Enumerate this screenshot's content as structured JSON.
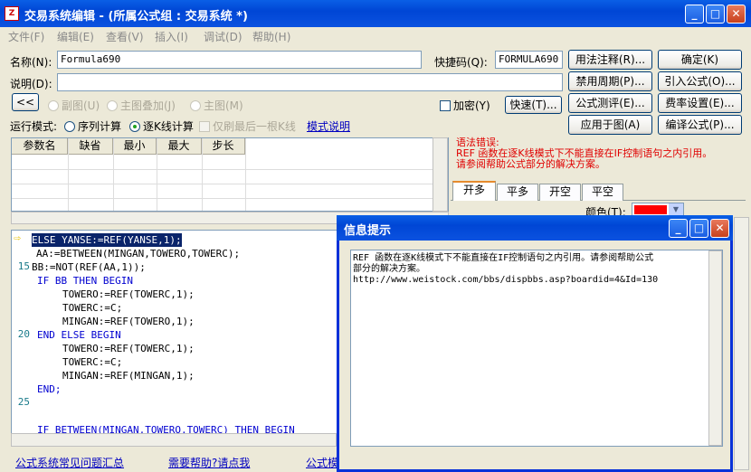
{
  "window": {
    "title": "交易系统编辑 - (所属公式组 : 交易系统 *)",
    "app_icon": "Z"
  },
  "menu": [
    "文件(F)",
    "编辑(E)",
    "查看(V)",
    "插入(I)",
    "调试(D)",
    "帮助(H)"
  ],
  "form": {
    "name_label": "名称(N):",
    "name_value": "Formula690",
    "code_label": "快捷码(Q):",
    "code_value": "FORMULA690",
    "desc_label": "说明(D):",
    "desc_value": ""
  },
  "buttons": {
    "usage": "用法注释(R)...",
    "ok": "确定(K)",
    "period": "禁用周期(P)...",
    "import": "引入公式(O)...",
    "test": "公式测评(E)...",
    "fee": "费率设置(E)...",
    "apply": "应用于图(A)",
    "compile": "编译公式(P)...",
    "quick": "快速(T)...",
    "collapse": "<<"
  },
  "chart_mode": {
    "sub": "副图(U)",
    "overlay": "主图叠加(J)",
    "main": "主图(M)"
  },
  "encrypt": "加密(Y)",
  "run_mode": {
    "label": "运行模式:",
    "seq": "序列计算",
    "kline": "逐K线计算",
    "last_only": "仅刷最后一根K线",
    "desc_link": "模式说明"
  },
  "param_headers": [
    "参数名",
    "缺省",
    "最小",
    "最大",
    "步长"
  ],
  "code_lines": [
    {
      "num": "",
      "text": "ELSE YANSE:=REF(YANSE,1);"
    },
    {
      "num": "",
      "text": "AA:=BETWEEN(MINGAN,TOWERO,TOWERC);"
    },
    {
      "num": "15",
      "text": "BB:=NOT(REF(AA,1));"
    },
    {
      "num": "",
      "text": "IF BB THEN BEGIN"
    },
    {
      "num": "",
      "text": "TOWERO:=REF(TOWERC,1);"
    },
    {
      "num": "",
      "text": "TOWERC:=C;"
    },
    {
      "num": "",
      "text": "MINGAN:=REF(TOWERO,1);"
    },
    {
      "num": "20",
      "text": "END ELSE BEGIN"
    },
    {
      "num": "",
      "text": "TOWERO:=REF(TOWERC,1);"
    },
    {
      "num": "",
      "text": "TOWERC:=C;"
    },
    {
      "num": "",
      "text": "MINGAN:=REF(MINGAN,1);"
    },
    {
      "num": "",
      "text": "END;"
    },
    {
      "num": "25",
      "text": ""
    },
    {
      "num": "",
      "text": ""
    },
    {
      "num": "",
      "text": "IF BETWEEN(MINGAN,TOWERO,TOWERC) THEN BEGIN"
    }
  ],
  "error": {
    "title": "语法错误:",
    "line1": "REF 函数在逐K线模式下不能直接在IF控制语句之内引用。",
    "line2": "请参阅帮助公式部分的解决方案。"
  },
  "signal_tabs": [
    "开多",
    "平多",
    "开空",
    "平空"
  ],
  "color_label": "颜色(T):",
  "colors": {
    "signal": "#ff0000"
  },
  "footer": {
    "faq": "公式系统常见问题汇总",
    "help": "需要帮助?请点我",
    "partial": "公式模"
  },
  "dialog": {
    "title": "信息提示",
    "line1": "REF 函数在逐K线模式下不能直接在IF控制语句之内引用。请参阅帮助公式",
    "line2": "部分的解决方案。",
    "url": "http://www.weistock.com/bbs/dispbbs.asp?boardid=4&Id=130"
  }
}
